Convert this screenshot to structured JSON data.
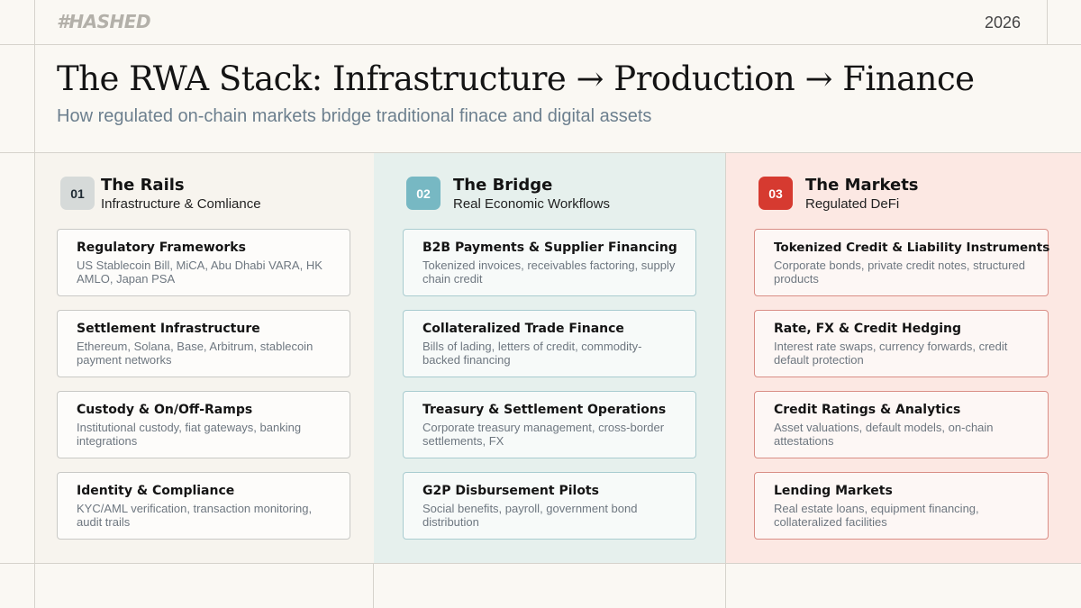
{
  "header": {
    "logo": "#HASHED",
    "year": "2026",
    "title": "The RWA Stack: Infrastructure → Production → Finance",
    "subtitle": "How regulated on-chain markets bridge traditional finace and digital assets"
  },
  "columns": [
    {
      "number": "01",
      "title": "The Rails",
      "subtitle": "Infrastructure & Comliance",
      "accent": "#d6dad9",
      "cards": [
        {
          "title": "Regulatory Frameworks",
          "desc": "US Stablecoin Bill, MiCA, Abu Dhabi VARA, HK AMLO, Japan PSA"
        },
        {
          "title": "Settlement Infrastructure",
          "desc": "Ethereum, Solana, Base, Arbitrum, stablecoin payment networks"
        },
        {
          "title": "Custody & On/Off-Ramps",
          "desc": "Institutional custody, fiat gateways, banking integrations"
        },
        {
          "title": "Identity & Compliance",
          "desc": "KYC/AML verification, transaction monitoring, audit trails"
        }
      ]
    },
    {
      "number": "02",
      "title": "The Bridge",
      "subtitle": "Real Economic Workflows",
      "accent": "#77b8c3",
      "cards": [
        {
          "title": "B2B Payments & Supplier Financing",
          "desc": "Tokenized invoices, receivables factoring, supply chain credit"
        },
        {
          "title": "Collateralized Trade Finance",
          "desc": "Bills of lading, letters of credit, commodity-backed financing"
        },
        {
          "title": "Treasury & Settlement Operations",
          "desc": "Corporate treasury management, cross-border settlements, FX"
        },
        {
          "title": "G2P Disbursement Pilots",
          "desc": "Social benefits, payroll, government bond distribution"
        }
      ]
    },
    {
      "number": "03",
      "title": "The Markets",
      "subtitle": "Regulated DeFi",
      "accent": "#d63a30",
      "cards": [
        {
          "title": "Tokenized Credit & Liability Instruments",
          "desc": "Corporate bonds, private credit notes, structured products"
        },
        {
          "title": "Rate, FX & Credit Hedging",
          "desc": "Interest rate swaps, currency forwards, credit default protection"
        },
        {
          "title": "Credit Ratings & Analytics",
          "desc": "Asset valuations, default models, on-chain attestations"
        },
        {
          "title": "Lending Markets",
          "desc": "Real estate loans, equipment financing, collateralized facilities"
        }
      ]
    }
  ]
}
